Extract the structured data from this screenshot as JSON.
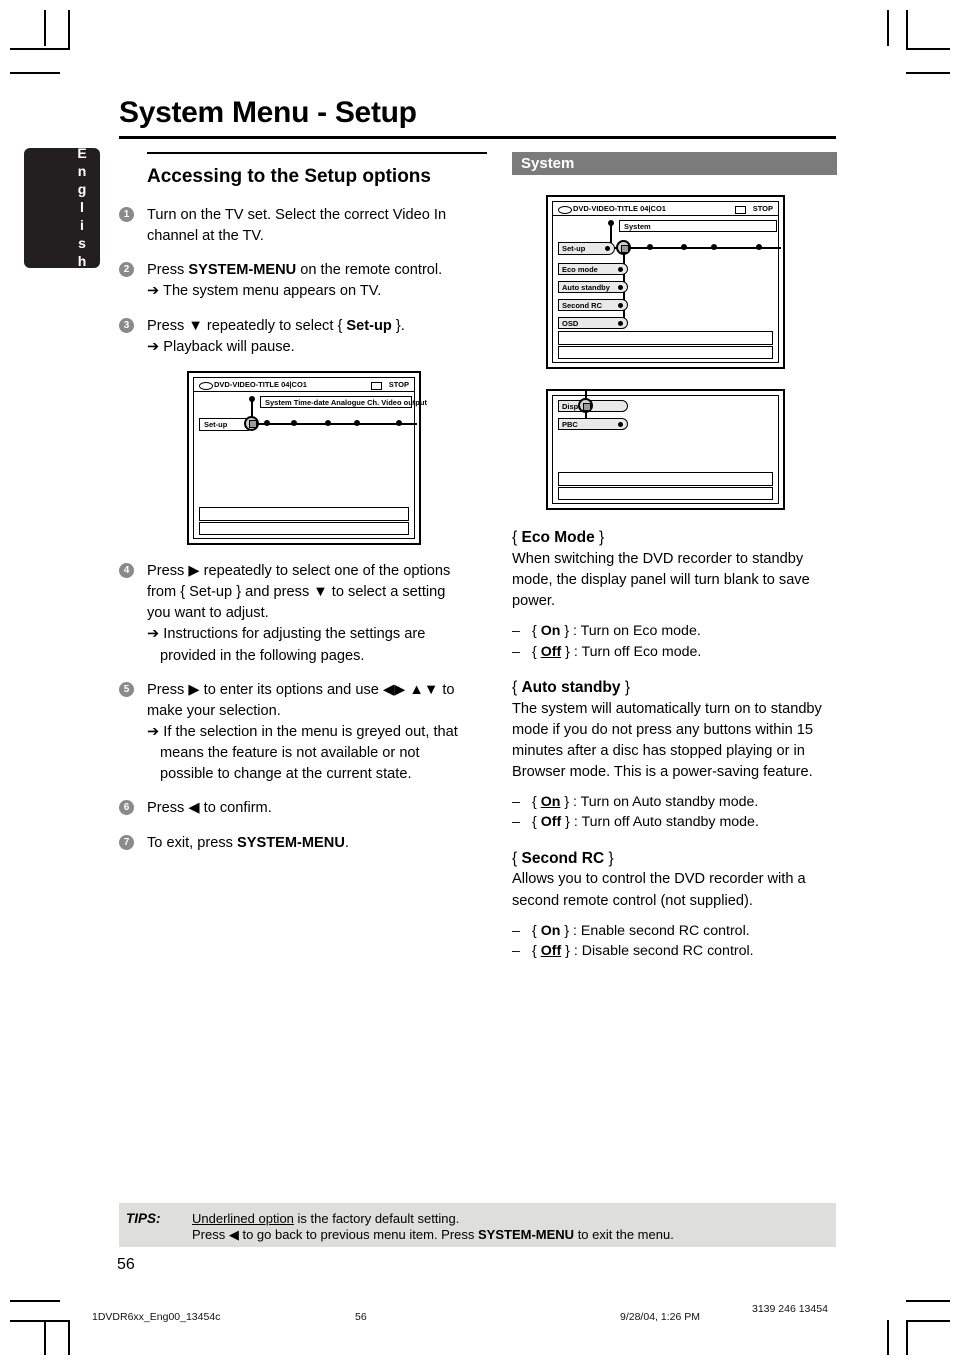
{
  "language_tab": {
    "label": "English"
  },
  "page_title": "System Menu - Setup",
  "left_column": {
    "section_heading": "Accessing to the Setup options",
    "steps": [
      {
        "num": "1",
        "text_a": "Turn on the TV set.  Select the correct Video In channel at the TV.",
        "sub": []
      },
      {
        "num": "2",
        "text_a": "Press ",
        "bold": "SYSTEM-MENU",
        "text_b": " on the remote control.",
        "sub": [
          "The system menu appears on TV."
        ]
      },
      {
        "num": "3",
        "text_a": "Press ▼ repeatedly to select { ",
        "bold": "Set-up",
        "text_b": " }.",
        "sub": [
          "Playback will pause."
        ]
      },
      {
        "num": "4",
        "text_a": "Press ▶ repeatedly to select one of the options from { Set-up } and press ▼ to select a setting you want to adjust.",
        "sub": [
          "Instructions for adjusting the settings are provided in the following pages."
        ]
      },
      {
        "num": "5",
        "text_a": "Press ▶ to enter its options and use ◀▶ ▲▼  to make your selection.",
        "sub": [
          "If the selection in the menu is greyed out, that means the feature is not available or not possible to change at the current state."
        ]
      },
      {
        "num": "6",
        "text_a": "Press ◀ to confirm.",
        "sub": []
      },
      {
        "num": "7",
        "text_a": "To exit, press ",
        "bold": "SYSTEM-MENU",
        "text_b": ".",
        "sub": []
      }
    ],
    "tv_screen": {
      "disc_label": "DVD-VIDEO-TITLE 04|CO1",
      "status_label": "STOP",
      "menu_tabs": "System  Time-date  Analogue Ch.  Video output",
      "selected_item": "Set-up"
    }
  },
  "right_column": {
    "section_bar": "System",
    "tv_screen_1": {
      "disc_label": "DVD-VIDEO-TITLE 04|CO1",
      "status_label": "STOP",
      "menu_tab": "System",
      "selected_item": "Set-up",
      "options": [
        "Eco mode",
        "Auto standby",
        "Second RC",
        "OSD"
      ]
    },
    "tv_screen_2": {
      "options": [
        "Display",
        "PBC"
      ]
    },
    "settings": [
      {
        "title_open": "{ ",
        "title": "Eco Mode",
        "title_close": " }",
        "body": "When switching the DVD recorder to standby mode, the display panel will turn blank to save power.",
        "options": [
          {
            "dash": "–",
            "open": "{ ",
            "name": "On",
            "underline": false,
            "close": " } ",
            "desc": ": Turn on Eco mode."
          },
          {
            "dash": "–",
            "open": "{ ",
            "name": "Off",
            "underline": true,
            "close": " } ",
            "desc": ": Turn off Eco mode."
          }
        ]
      },
      {
        "title_open": "{ ",
        "title": "Auto standby",
        "title_close": " }",
        "body": "The system will automatically turn on to standby mode if you do not press any buttons within 15 minutes after a disc has stopped playing or in Browser mode. This is a power-saving feature.",
        "options": [
          {
            "dash": "–",
            "open": "{ ",
            "name": "On",
            "underline": true,
            "close": " } ",
            "desc": ": Turn on Auto standby mode."
          },
          {
            "dash": "–",
            "open": "{ ",
            "name": "Off",
            "underline": false,
            "close": " } ",
            "desc": ": Turn off Auto standby mode."
          }
        ]
      },
      {
        "title_open": "{ ",
        "title": "Second RC",
        "title_close": " }",
        "body": "Allows you to control the DVD recorder with a second remote control (not supplied).",
        "options": [
          {
            "dash": "–",
            "open": "{ ",
            "name": "On",
            "underline": false,
            "close": " } ",
            "desc": ": Enable second RC control."
          },
          {
            "dash": "–",
            "open": "{ ",
            "name": "Off",
            "underline": true,
            "close": " } ",
            "desc": ": Disable second RC control."
          }
        ]
      }
    ]
  },
  "tips": {
    "label": "TIPS:",
    "line1_underlined": "Underlined option",
    "line1_rest": " is the factory default setting.",
    "line2_a": "Press ◀ to go back to previous menu item.  Press ",
    "line2_bold": "SYSTEM-MENU",
    "line2_b": " to exit the menu."
  },
  "page_number": "56",
  "footer": {
    "file": "1DVDR6xx_Eng00_13454c",
    "page": "56",
    "date": "9/28/04, 1:26 PM",
    "code": "3139 246 13454"
  }
}
